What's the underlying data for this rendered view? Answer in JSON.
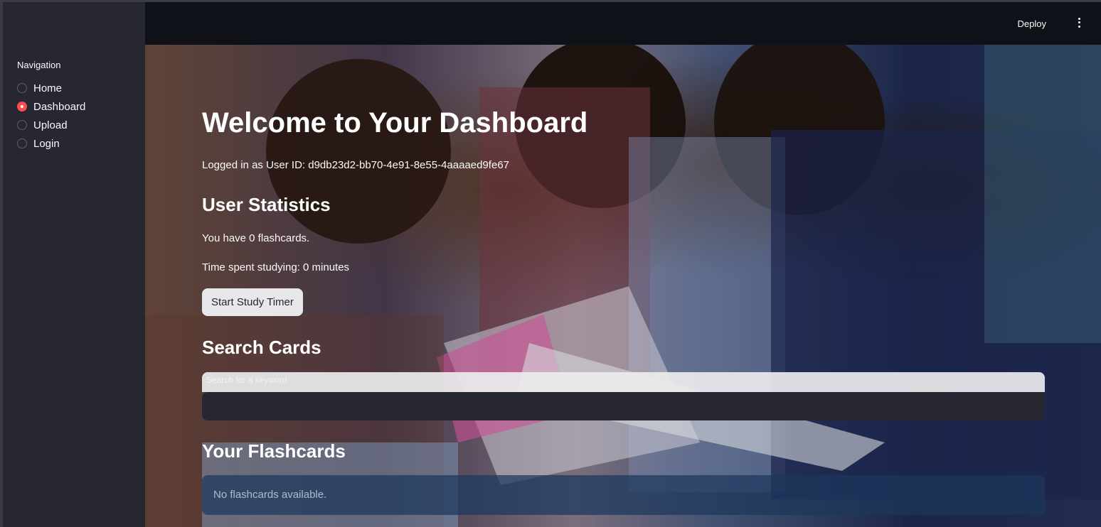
{
  "sidebar": {
    "nav_label": "Navigation",
    "items": [
      {
        "label": "Home",
        "selected": false
      },
      {
        "label": "Dashboard",
        "selected": true
      },
      {
        "label": "Upload",
        "selected": false
      },
      {
        "label": "Login",
        "selected": false
      }
    ]
  },
  "header": {
    "deploy_label": "Deploy",
    "menu_icon": "vertical-dots-icon"
  },
  "main": {
    "title": "Welcome to Your Dashboard",
    "user_line": "Logged in as User ID: d9db23d2-bb70-4e91-8e55-4aaaaed9fe67",
    "stats_heading": "User Statistics",
    "flashcard_count_text": "You have 0 flashcards.",
    "time_text": "Time spent studying: 0 minutes",
    "timer_button": "Start Study Timer",
    "search_heading": "Search Cards",
    "search_label": "Search for a keyword",
    "search_value": "",
    "flashcards_heading": "Your Flashcards",
    "empty_message": "No flashcards available."
  },
  "colors": {
    "accent": "#ff4b4b",
    "sidebar_bg": "#262730",
    "app_bg": "#0e1117",
    "info_bg": "#1c385d"
  }
}
